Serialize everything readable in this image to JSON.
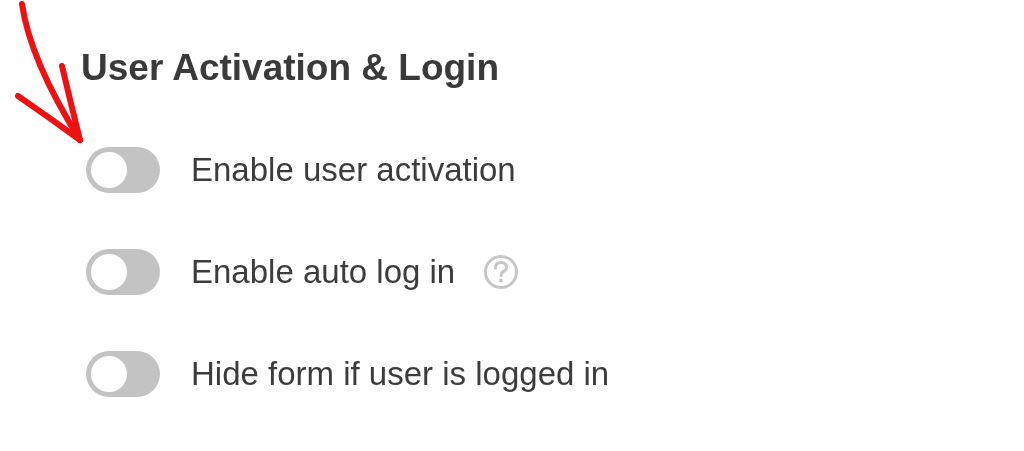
{
  "section": {
    "title": "User Activation & Login",
    "toggles": [
      {
        "label": "Enable user activation",
        "on": false,
        "help_icon": false
      },
      {
        "label": "Enable auto log in",
        "on": false,
        "help_icon": true
      },
      {
        "label": "Hide form if user is logged in",
        "on": false,
        "help_icon": false
      }
    ]
  }
}
